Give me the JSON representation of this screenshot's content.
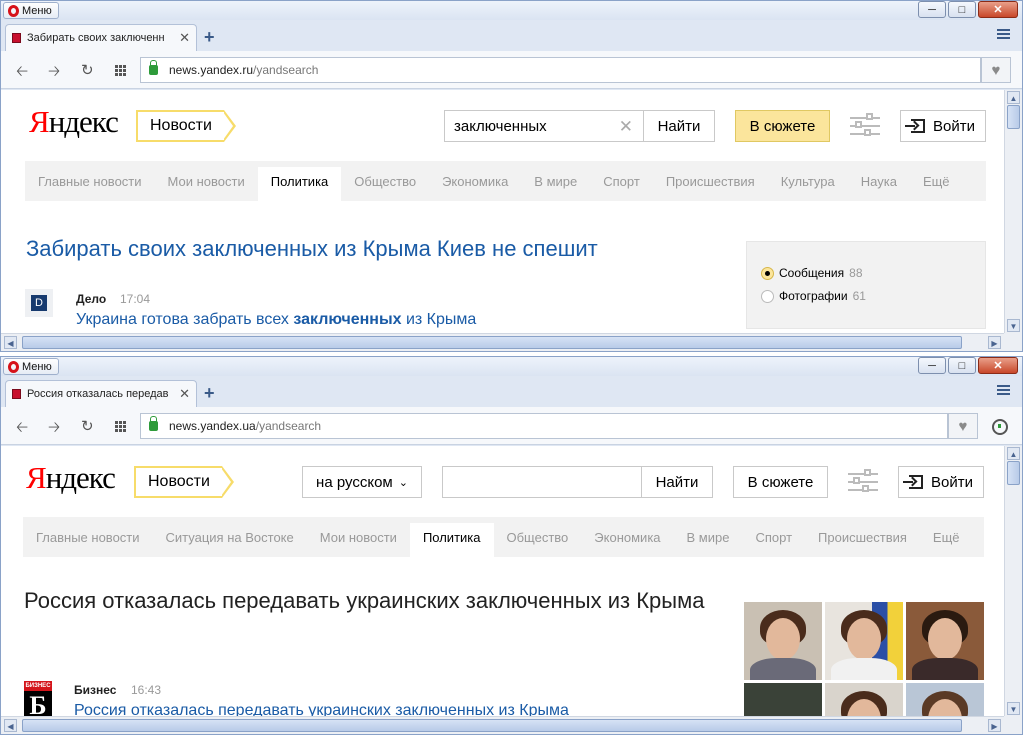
{
  "browser": {
    "menu_label": "Меню"
  },
  "window1": {
    "tab_title": "Забирать своих заключенн",
    "url_host": "news.yandex.ru",
    "url_path": "/yandsearch",
    "logo": {
      "first": "Я",
      "rest": "ндекс"
    },
    "service": "Новости",
    "search_value": "заключенных",
    "find_label": "Найти",
    "story_label": "В сюжете",
    "login_label": "Войти",
    "nav": [
      "Главные новости",
      "Мои новости",
      "Политика",
      "Общество",
      "Экономика",
      "В мире",
      "Спорт",
      "Происшествия",
      "Культура",
      "Наука",
      "Ещё"
    ],
    "nav_active": "Политика",
    "headline": "Забирать своих заключенных из Крыма Киев не спешит",
    "source": {
      "icon_letter": "D",
      "name": "Дело",
      "time": "17:04"
    },
    "snippet": {
      "before": "Украина готова забрать всех ",
      "bold": "заключенных",
      "after": " из Крыма"
    },
    "filters": [
      {
        "label": "Сообщения",
        "count": "88",
        "selected": true
      },
      {
        "label": "Фотографии",
        "count": "61",
        "selected": false
      }
    ]
  },
  "window2": {
    "tab_title": "Россия отказалась передав",
    "url_host": "news.yandex.ua",
    "url_path": "/yandsearch",
    "logo": {
      "first": "Я",
      "rest": "ндекс"
    },
    "service": "Новости",
    "lang_label": "на русском",
    "search_value": "",
    "find_label": "Найти",
    "story_label": "В сюжете",
    "login_label": "Войти",
    "nav": [
      "Главные новости",
      "Ситуация на Востоке",
      "Мои новости",
      "Политика",
      "Общество",
      "Экономика",
      "В мире",
      "Спорт",
      "Происшествия",
      "Ещё"
    ],
    "nav_active": "Политика",
    "headline": "Россия отказалась передавать украинских заключенных из Крыма",
    "source": {
      "icon_top": "БИЗНЕС",
      "icon_glyph": "Б",
      "name": "Бизнес",
      "time": "16:43"
    },
    "snippet": "Россия отказалась передавать украинских заключенных из Крыма"
  },
  "colors": {
    "link": "#1a5ba6",
    "logo_red": "#ff0000",
    "service_yellow": "#f7dc6a",
    "active_story": "#fbe59c",
    "nav_bg": "#f2f2f2",
    "secure_green": "#2e9b3a"
  },
  "icons": [
    "opera-logo-icon",
    "minimize-icon",
    "maximize-icon",
    "close-icon",
    "tab-favicon-icon",
    "tab-close-icon",
    "new-tab-icon",
    "tab-menu-icon",
    "back-icon",
    "forward-icon",
    "reload-icon",
    "speed-dial-icon",
    "secure-lock-icon",
    "heart-icon",
    "clear-search-icon",
    "settings-sliders-icon",
    "login-icon",
    "chevron-down-icon",
    "history-clock-icon"
  ]
}
